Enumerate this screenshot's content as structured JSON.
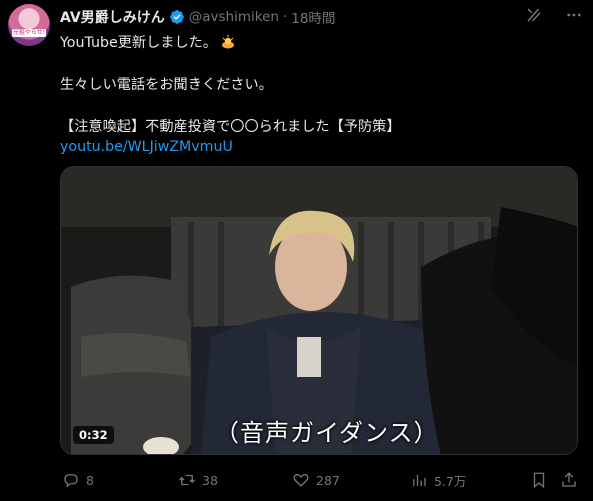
{
  "tweet": {
    "author_name": "AV男爵しみけん",
    "author_handle": "@avshimiken",
    "separator": "·",
    "time_ago": "18時間",
    "avatar_badge": "元祖やらせ!",
    "lines": [
      "YouTube更新しました。",
      "生々しい電話をお聞きください。",
      "【注意喚起】不動産投資で〇〇られました【予防策】"
    ],
    "link": "youtu.be/WLJiwZMvmuU"
  },
  "video": {
    "duration": "0:32",
    "caption": "（音声ガイダンス）"
  },
  "actions": {
    "replies": "8",
    "retweets": "38",
    "likes": "287",
    "views": "5.7万"
  },
  "colors": {
    "background": "#000000",
    "text": "#e7e9ea",
    "muted": "#71767b",
    "link": "#1d9bf0"
  },
  "icons": [
    "grok-icon",
    "more-icon",
    "verified-icon",
    "reply-icon",
    "retweet-icon",
    "like-icon",
    "views-icon",
    "bookmark-icon",
    "share-icon"
  ]
}
